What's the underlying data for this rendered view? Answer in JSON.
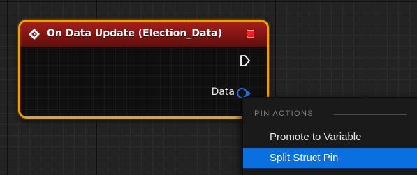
{
  "node": {
    "title": "On Data Update (Election_Data)",
    "output_pin_label": "Data",
    "colors": {
      "header": "#8b1a16",
      "border": "#f0a000",
      "delegate_pin": "#ff1f1f",
      "struct_pin": "#1875e0"
    },
    "icons": {
      "event": "event-diamond-icon",
      "delegate": "delegate-pin-icon",
      "exec": "exec-pin-icon",
      "data": "struct-pin-icon"
    }
  },
  "context_menu": {
    "section_title": "PIN ACTIONS",
    "items": [
      {
        "label": "Promote to Variable",
        "highlighted": false
      },
      {
        "label": "Split Struct Pin",
        "highlighted": true
      }
    ],
    "highlight_color": "#0a70e0"
  }
}
